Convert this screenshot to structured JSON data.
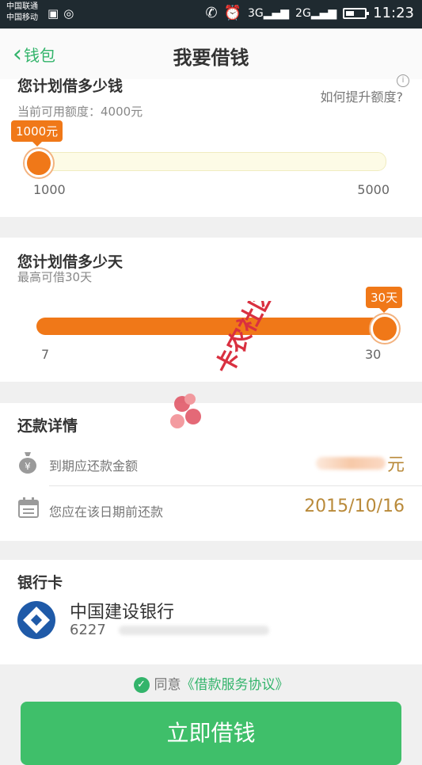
{
  "status_bar": {
    "carrier1": "中国联通",
    "carrier2": "中国移动",
    "net1": "3G",
    "net2": "2G",
    "time": "11:23"
  },
  "nav": {
    "back_label": "钱包",
    "title": "我要借钱"
  },
  "amount": {
    "title": "您计划借多少钱",
    "available": "当前可用额度：4000元",
    "raise_link": "如何提升额度?",
    "info_glyph": "i",
    "bubble": "1000元",
    "min": "1000",
    "max": "5000",
    "value": 1000
  },
  "days": {
    "title": "您计划借多少天",
    "subtitle": "最高可借30天",
    "bubble": "30天",
    "min": "7",
    "max": "30",
    "value": 30
  },
  "repay": {
    "title": "还款详情",
    "amount_label": "到期应还款金额",
    "amount_suffix": "元",
    "date_label": "您应在该日期前还款",
    "date_value": "2015/10/16"
  },
  "bank": {
    "title": "银行卡",
    "name": "中国建设银行",
    "number_prefix": "6227"
  },
  "agreement": {
    "prefix": "同意",
    "link": "《借款服务协议》"
  },
  "submit_label": "立即借钱",
  "watermark_text": "卡农社区",
  "colors": {
    "accent_green": "#3fbf6a",
    "slider_orange": "#f07818",
    "date_gold": "#b98a3a"
  }
}
